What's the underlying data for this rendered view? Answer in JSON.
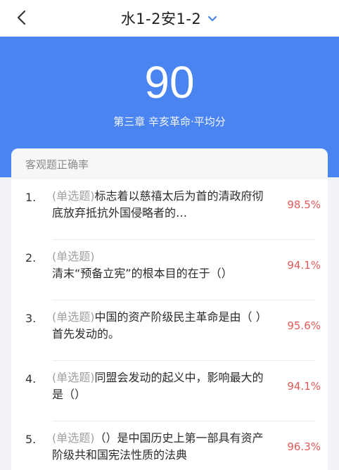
{
  "header": {
    "title": "水1-2安1-2",
    "back_icon": "back-arrow-icon",
    "dropdown_icon": "chevron-down-icon"
  },
  "hero": {
    "score": "90",
    "subtitle": "第三章 辛亥革命·平均分",
    "background": "#4a84f0"
  },
  "card": {
    "header": "客观题正确率"
  },
  "questions": [
    {
      "num": "1.",
      "tag": "(单选题)",
      "text": "标志着以慈禧太后为首的清政府彻底放弃抵抗外国侵略者的…",
      "rate": "98.5%"
    },
    {
      "num": "2.",
      "tag": "(单选题)",
      "text": "清末“预备立宪”的根本目的在于（）",
      "rate": "94.1%"
    },
    {
      "num": "3.",
      "tag": "(单选题)",
      "text": "中国的资产阶级民主革命是由（ ）首先发动的。",
      "rate": "95.6%"
    },
    {
      "num": "4.",
      "tag": "(单选题)",
      "text": "同盟会发动的起义中，影响最大的是（）",
      "rate": "94.1%"
    },
    {
      "num": "5.",
      "tag": "(单选题)",
      "text": "（）是中国历史上第一部具有资产阶级共和国宪法性质的法典",
      "rate": "96.3%"
    }
  ],
  "colors": {
    "accent": "#4a84f0",
    "rate": "#e05a5a",
    "tag": "#a0a0a0"
  }
}
